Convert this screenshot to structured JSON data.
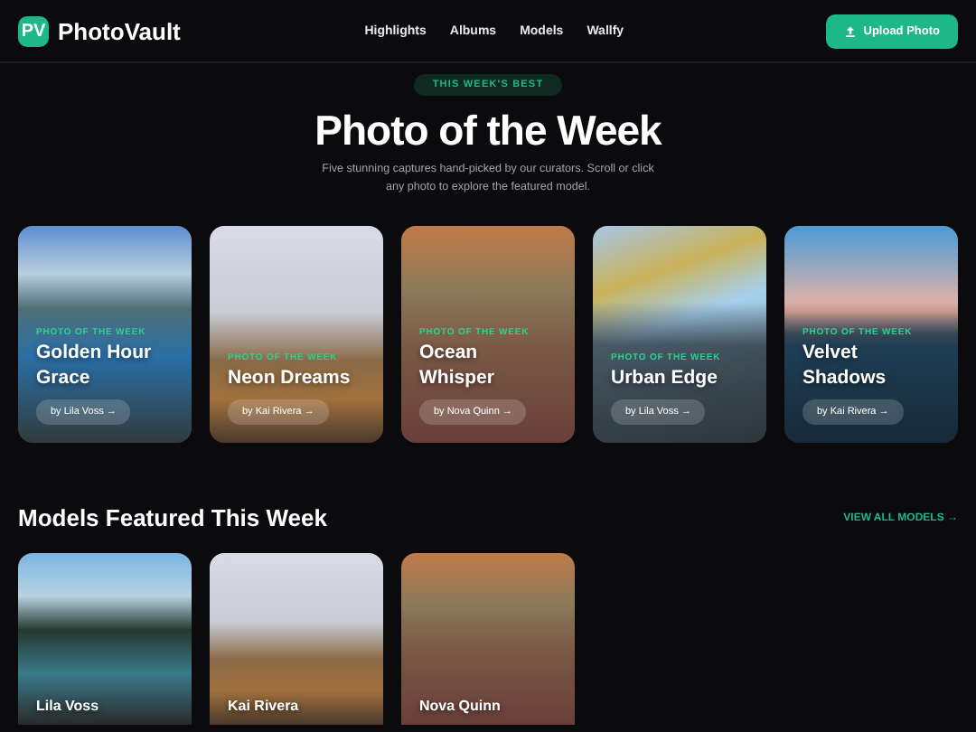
{
  "header": {
    "logo_mark": "PV",
    "brand": "PhotoVault",
    "nav": [
      "Highlights",
      "Albums",
      "Models",
      "Wallfy"
    ],
    "upload_button": "Upload Photo"
  },
  "hero": {
    "badge": "THIS WEEK'S BEST",
    "title": "Photo of the Week",
    "subtitle": "Five stunning captures hand-picked by our curators. Scroll or click any photo to explore the featured model."
  },
  "photos": [
    {
      "eyebrow": "PHOTO OF THE WEEK",
      "title": "Golden Hour Grace",
      "author": "by Lila Voss",
      "arrow": "→"
    },
    {
      "eyebrow": "PHOTO OF THE WEEK",
      "title": "Neon Dreams",
      "author": "by Kai Rivera",
      "arrow": "→"
    },
    {
      "eyebrow": "PHOTO OF THE WEEK",
      "title": "Ocean Whisper",
      "author": "by Nova Quinn",
      "arrow": "→"
    },
    {
      "eyebrow": "PHOTO OF THE WEEK",
      "title": "Urban Edge",
      "author": "by Lila Voss",
      "arrow": "→"
    },
    {
      "eyebrow": "PHOTO OF THE WEEK",
      "title": "Velvet Shadows",
      "author": "by Kai Rivera",
      "arrow": "→"
    }
  ],
  "models_section": {
    "title": "Models Featured This Week",
    "view_all": "VIEW ALL MODELS",
    "view_all_arrow": "→",
    "models": [
      {
        "name": "Lila Voss"
      },
      {
        "name": "Kai Rivera"
      },
      {
        "name": "Nova Quinn"
      }
    ]
  }
}
